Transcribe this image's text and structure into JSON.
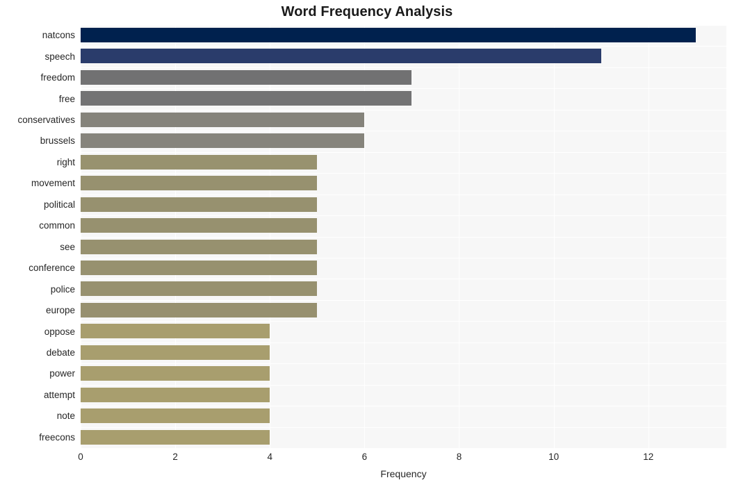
{
  "chart_data": {
    "type": "bar",
    "orientation": "horizontal",
    "title": "Word Frequency Analysis",
    "xlabel": "Frequency",
    "ylabel": "",
    "xlim": [
      0,
      13.65
    ],
    "xticks": [
      0,
      2,
      4,
      6,
      8,
      10,
      12
    ],
    "xticklabels": [
      "0",
      "2",
      "4",
      "6",
      "8",
      "10",
      "12"
    ],
    "grid": true,
    "grid_axis": "both",
    "legend": false,
    "categories": [
      "natcons",
      "speech",
      "freedom",
      "free",
      "conservatives",
      "brussels",
      "right",
      "movement",
      "political",
      "common",
      "see",
      "conference",
      "police",
      "europe",
      "oppose",
      "debate",
      "power",
      "attempt",
      "note",
      "freecons"
    ],
    "values": [
      13,
      11,
      7,
      7,
      6,
      6,
      5,
      5,
      5,
      5,
      5,
      5,
      5,
      5,
      4,
      4,
      4,
      4,
      4,
      4
    ],
    "bar_colors": [
      "#00214e",
      "#2a3c6b",
      "#717172",
      "#737374",
      "#85837b",
      "#86847c",
      "#98926f",
      "#97916f",
      "#97916f",
      "#97916f",
      "#97916f",
      "#97916f",
      "#97916f",
      "#97906f",
      "#a89e6e",
      "#a89e6e",
      "#a89e6e",
      "#a89e6e",
      "#a89e6e",
      "#a89e6e"
    ],
    "plot_background": "#f7f7f7",
    "grid_color": "#ffffff",
    "figure_background": "#ffffff"
  }
}
